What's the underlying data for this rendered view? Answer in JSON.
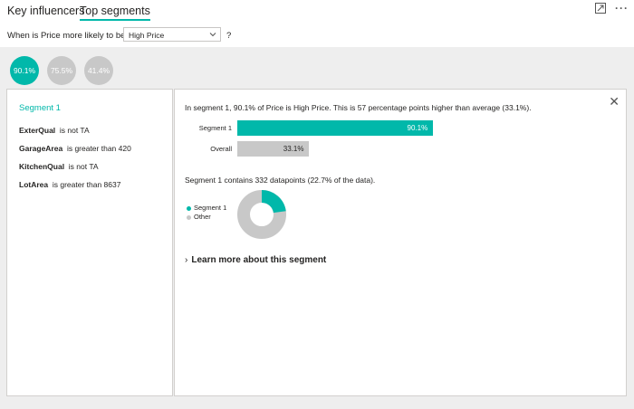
{
  "tabs": [
    {
      "label": "Key influencers",
      "active": false
    },
    {
      "label": "Top segments",
      "active": true
    }
  ],
  "top_icons": [
    "focus-mode-icon",
    "more-options-icon"
  ],
  "question": {
    "prefix": "When is Price more likely to be",
    "selected": "High Price",
    "suffix": "?"
  },
  "segment_circles": [
    {
      "label": "90.1%",
      "active": true
    },
    {
      "label": "75.5%",
      "active": false
    },
    {
      "label": "41.4%",
      "active": false
    }
  ],
  "segment": {
    "title": "Segment 1",
    "conditions": [
      {
        "field": "ExterQual",
        "rule": "is not TA"
      },
      {
        "field": "GarageArea",
        "rule": "is greater than 420"
      },
      {
        "field": "KitchenQual",
        "rule": "is not TA"
      },
      {
        "field": "LotArea",
        "rule": "is greater than 8637"
      }
    ]
  },
  "details": {
    "summary": "In segment 1, 90.1% of Price is High Price. This is 57 percentage points higher than average (33.1%).",
    "bars": [
      {
        "label": "Segment 1",
        "value": 90.1,
        "text": "90.1%",
        "color": "#01B8AA",
        "text_color": "#ffffff"
      },
      {
        "label": "Overall",
        "value": 33.1,
        "text": "33.1%",
        "color": "#c8c8c8",
        "text_color": "#252423"
      }
    ],
    "bar_max": 100,
    "datapoints": "Segment 1 contains 332 datapoints (22.7% of the data).",
    "donut": {
      "segment_fraction": 0.227
    },
    "legend": [
      {
        "label": "Segment 1",
        "color": "#01B8AA"
      },
      {
        "label": "Other",
        "color": "#c8c8c8"
      }
    ],
    "learn_more": "Learn more about this segment"
  },
  "colors": {
    "accent": "#01B8AA",
    "neutral": "#c8c8c8"
  }
}
